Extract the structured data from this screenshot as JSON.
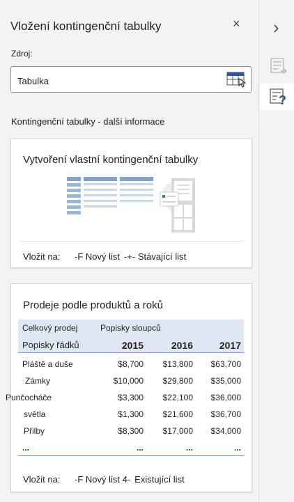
{
  "pane": {
    "title": "Vložení kontingenční tabulky",
    "close_glyph": "×",
    "source_label": "Zdroj:",
    "source_value": "Tabulka",
    "more_info": "Kontingenční tabulky - další informace"
  },
  "card_custom": {
    "title": "Vytvoření vlastní kontingenční tabulky",
    "insert_label": "Vložit na:",
    "opt_new": "-F Nový list",
    "opt_existing": "-+- Stávající list"
  },
  "card_sales": {
    "title": "Prodeje podle produktů a roků",
    "header_total": "Celkový prodej",
    "header_cols": "Popisky sloupců",
    "header_rows": "Popisky řádků",
    "years": [
      "2015",
      "2016",
      "2017"
    ],
    "rows": [
      {
        "label": "Pláště a duše",
        "v": [
          "$8,700",
          "$13,800",
          "$63,700"
        ]
      },
      {
        "label": "Zámky",
        "v": [
          "$10,000",
          "$29,800",
          "$35,000"
        ]
      },
      {
        "label": "Punčocháče",
        "v": [
          "$3,300",
          "$22,100",
          "$36,000"
        ]
      },
      {
        "label": "světla",
        "v": [
          "$1,300",
          "$21,600",
          "$36,700"
        ]
      },
      {
        "label": "Přilby",
        "v": [
          "$8,300",
          "$17,000",
          "$34,000"
        ]
      },
      {
        "label": "...",
        "v": [
          "...",
          "...",
          "..."
        ]
      }
    ],
    "insert_label": "Vložit na:",
    "opt_new": "-F Nový list 4-",
    "opt_existing": "Existující list"
  },
  "rail": {
    "expand_glyph": "›"
  },
  "colors": {
    "accent": "#2b579a",
    "header_bg": "#dfe8f2",
    "illus_blue": "#9db6de"
  }
}
